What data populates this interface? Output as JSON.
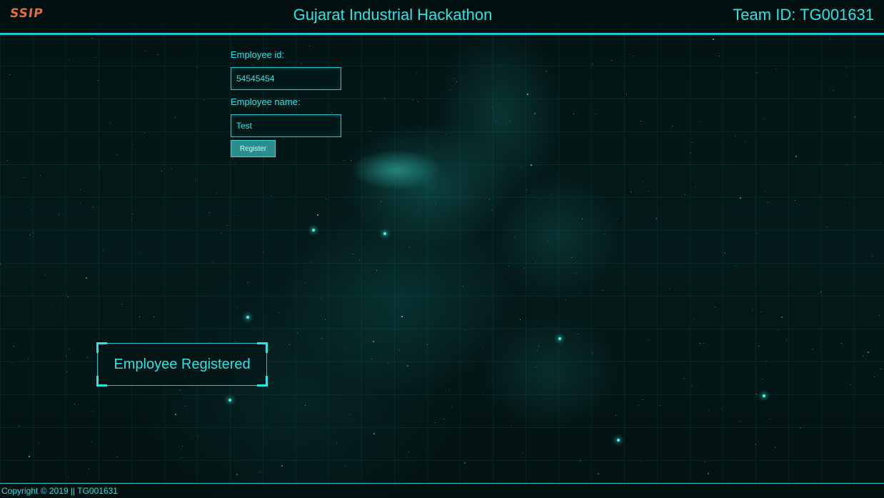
{
  "header": {
    "logo_text": "SSIP",
    "title": "Gujarat Industrial Hackathon",
    "team_id": "Team ID: TG001631"
  },
  "form": {
    "employee_id_label": "Employee id:",
    "employee_id_value": "54545454",
    "employee_name_label": "Employee name:",
    "employee_name_value": "Test",
    "register_label": "Register"
  },
  "message": {
    "text": "Employee Registered"
  },
  "footer": {
    "text": "Copyright © 2019 || TG001631"
  },
  "colors": {
    "accent": "#2fe3e3",
    "border": "#1ec8c8",
    "logo": "#e2703a",
    "background": "#041414",
    "button": "#2b8e8e"
  }
}
